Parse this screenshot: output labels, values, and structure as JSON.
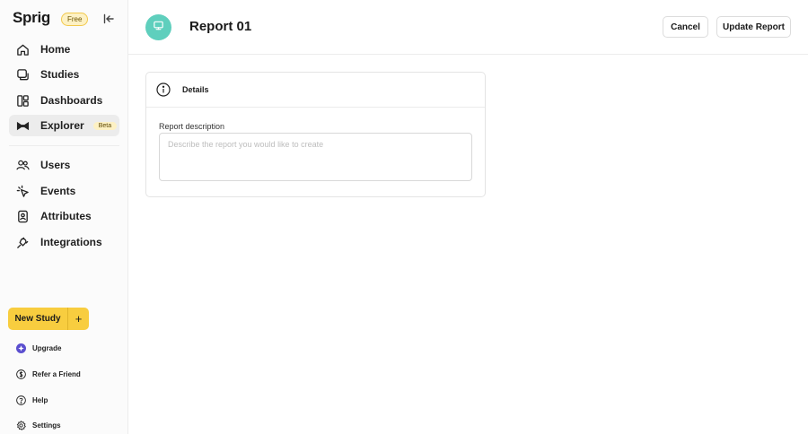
{
  "sidebar": {
    "logo": "Sprig",
    "plan_badge": "Free",
    "collapse_icon": "collapse-left-icon",
    "nav": {
      "home": {
        "label": "Home",
        "icon": "home-icon"
      },
      "studies": {
        "label": "Studies",
        "icon": "chat-bubble-icon"
      },
      "dashboards": {
        "label": "Dashboards",
        "icon": "dashboard-icon"
      },
      "explorer": {
        "label": "Explorer",
        "icon": "bowtie-icon",
        "badge": "Beta",
        "active": true
      },
      "users": {
        "label": "Users",
        "icon": "users-icon"
      },
      "events": {
        "label": "Events",
        "icon": "events-icon"
      },
      "attributes": {
        "label": "Attributes",
        "icon": "attributes-icon"
      },
      "integrations": {
        "label": "Integrations",
        "icon": "plug-icon"
      }
    },
    "new_study": {
      "label": "New Study",
      "plus": "+"
    },
    "footer": {
      "upgrade": {
        "label": "Upgrade",
        "icon": "upgrade-icon"
      },
      "refer": {
        "label": "Refer a Friend",
        "icon": "dollar-icon"
      },
      "help": {
        "label": "Help",
        "icon": "help-icon"
      },
      "settings": {
        "label": "Settings",
        "icon": "gear-icon"
      }
    }
  },
  "header": {
    "title": "Report 01",
    "avatar_icon": "monitor-icon",
    "avatar_color": "#5fcfbd",
    "cancel_label": "Cancel",
    "update_label": "Update Report"
  },
  "details": {
    "title": "Details",
    "icon": "info-icon",
    "description_label": "Report description",
    "description_value": "",
    "description_placeholder": "Describe the report you would like to create"
  },
  "colors": {
    "accent_yellow": "#f8cd3f",
    "badge_yellow": "#fdf1c4",
    "teal": "#5fcfbd",
    "upgrade_purple": "#5b4fcf"
  }
}
